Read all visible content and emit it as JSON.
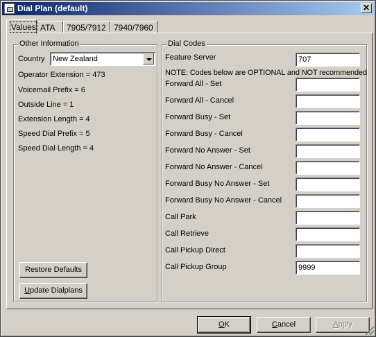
{
  "window": {
    "title": "Dial Plan (default)",
    "close_glyph": "✕"
  },
  "tabs": [
    {
      "label": "Values"
    },
    {
      "label": "ATA"
    },
    {
      "label": "7905/7912"
    },
    {
      "label": "7940/7960"
    }
  ],
  "other_info": {
    "title": "Other Information",
    "country_label": "Country",
    "country_value": "New Zealand",
    "lines": [
      "Operator Extension = 473",
      "Voicemail Prefix = 6",
      "Outside Line = 1",
      "Extension Length = 4",
      "Speed Dial Prefix = 5",
      "Speed Dial Length = 4"
    ],
    "restore_button": "Restore Defaults",
    "update_button": {
      "accel": "U",
      "rest": "pdate Dialplans"
    }
  },
  "dial_codes": {
    "title": "Dial Codes",
    "feature_server_label": "Feature Server",
    "feature_server_value": "707",
    "note": "NOTE: Codes below are OPTIONAL and NOT recommended",
    "rows": [
      {
        "label": "Forward All - Set",
        "value": ""
      },
      {
        "label": "Forward All - Cancel",
        "value": ""
      },
      {
        "label": "Forward Busy - Set",
        "value": ""
      },
      {
        "label": "Forward Busy - Cancel",
        "value": ""
      },
      {
        "label": "Forward No Answer - Set",
        "value": ""
      },
      {
        "label": "Forward No Answer - Cancel",
        "value": ""
      },
      {
        "label": "Forward Busy No Answer - Set",
        "value": ""
      },
      {
        "label": "Forward Busy No Answer - Cancel",
        "value": ""
      },
      {
        "label": "Call Park",
        "value": ""
      },
      {
        "label": "Call Retrieve",
        "value": ""
      },
      {
        "label": "Call Pickup Direct",
        "value": ""
      },
      {
        "label": "Call Pickup Group",
        "value": "9999"
      }
    ]
  },
  "footer": {
    "ok": {
      "accel": "O",
      "rest": "K"
    },
    "cancel": {
      "accel": "C",
      "rest": "ancel"
    },
    "apply": {
      "accel": "A",
      "rest": "pply"
    }
  },
  "colors": {
    "titlebar_start": "#0a246a",
    "titlebar_end": "#a6caf0",
    "face": "#d4d0c8"
  }
}
